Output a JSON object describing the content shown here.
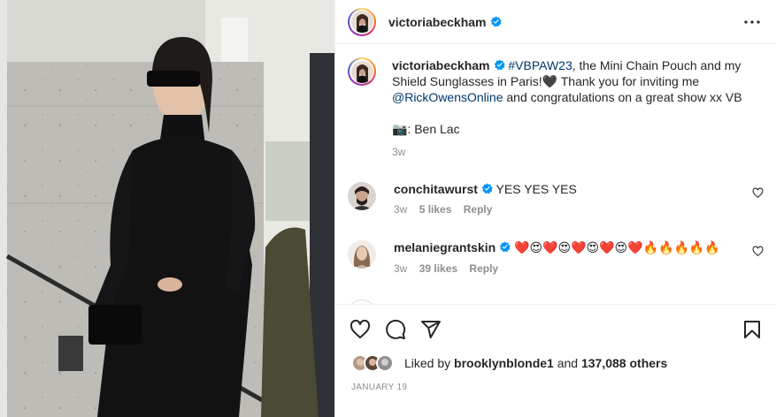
{
  "post": {
    "username": "victoriabeckham",
    "verified": true,
    "more_icon": "more-horizontal-icon"
  },
  "caption": {
    "username": "victoriabeckham",
    "hashtag": "#VBPAW23",
    "text_1": ", the Mini Chain Pouch and my Shield Sunglasses in Paris!",
    "emoji_heart": "🖤",
    "text_2": " Thank you for inviting me ",
    "mention": "@RickOwensOnline",
    "text_3": " and congratulations on a great show xx VB",
    "credit_emoji": "📷",
    "credit_text": ": Ben Lac",
    "time": "3w"
  },
  "comments": [
    {
      "username": "conchitawurst",
      "verified": true,
      "text": "YES YES YES",
      "time": "3w",
      "likes": "5 likes",
      "reply": "Reply"
    },
    {
      "username": "melaniegrantskin",
      "verified": true,
      "text": "❤️😍❤️😍❤️😍❤️😍❤️🔥🔥🔥🔥🔥",
      "time": "3w",
      "likes": "39 likes",
      "reply": "Reply"
    }
  ],
  "actions": {
    "like_icon": "heart-icon",
    "comment_icon": "comment-icon",
    "share_icon": "share-icon",
    "save_icon": "bookmark-icon"
  },
  "likes": {
    "prefix": "Liked by ",
    "user": "brooklynblonde1",
    "middle": " and ",
    "count": "137,088 others"
  },
  "date": "JANUARY 19",
  "colors": {
    "text": "#262626",
    "muted": "#8e8e8e",
    "link": "#00376b",
    "verified": "#0095f6",
    "border": "#efefef"
  }
}
